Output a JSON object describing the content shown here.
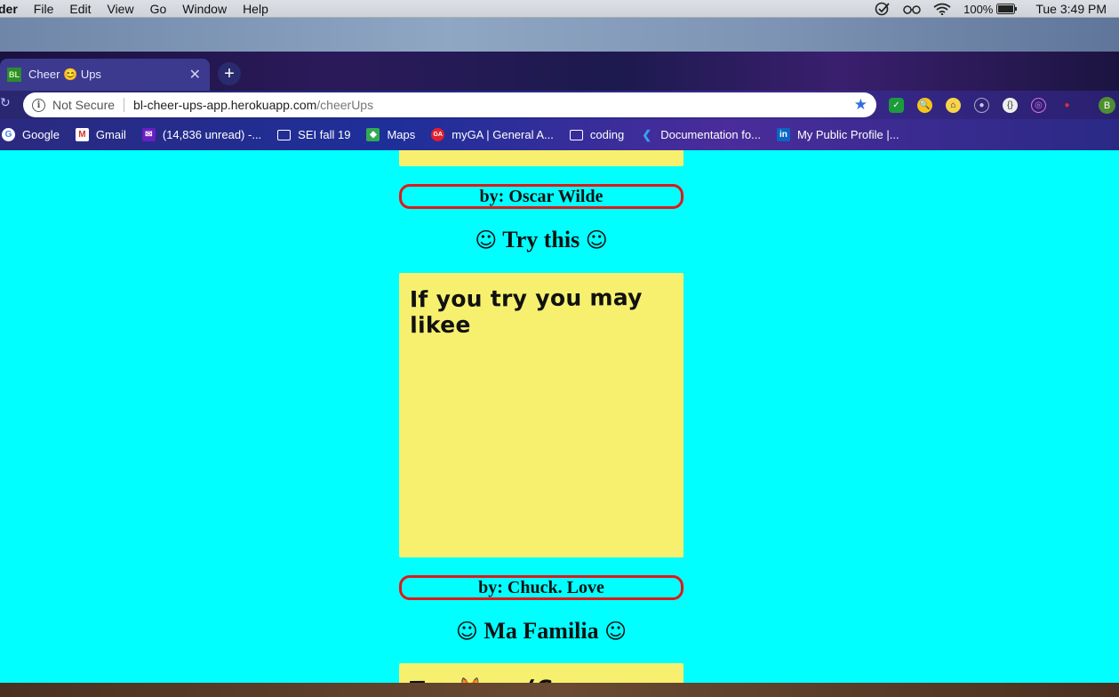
{
  "menubar": {
    "app_name": "der",
    "items": [
      "File",
      "Edit",
      "View",
      "Go",
      "Window",
      "Help"
    ],
    "battery": "100%",
    "clock": "Tue 3:49 PM"
  },
  "browser": {
    "tab_title": "Cheer 😊 Ups",
    "tab_favicon": "BL",
    "security_label": "Not Secure",
    "url_host": "bl-cheer-ups-app.herokuapp.com",
    "url_path": "/cheerUps",
    "profile_initial": "B",
    "bookmarks": [
      {
        "label": "Google",
        "icon": "google-icon"
      },
      {
        "label": "Gmail",
        "icon": "gmail-icon"
      },
      {
        "label": "(14,836 unread) -...",
        "icon": "yahoo-mail-icon"
      },
      {
        "label": "SEI fall 19",
        "icon": "folder-icon"
      },
      {
        "label": "Maps",
        "icon": "maps-icon"
      },
      {
        "label": "myGA | General A...",
        "icon": "ga-icon"
      },
      {
        "label": "coding",
        "icon": "folder-icon"
      },
      {
        "label": "Documentation fo...",
        "icon": "vscode-icon"
      },
      {
        "label": "My Public Profile |...",
        "icon": "linkedin-icon"
      }
    ]
  },
  "page": {
    "background": "#00ffff",
    "note_color": "#f7f06f",
    "author_border": "#e01818",
    "cards": [
      {
        "author": "by: Oscar Wilde"
      },
      {
        "heading": "Try this",
        "text": "If you try you may likee",
        "author": "by: Chuck. Love"
      },
      {
        "heading": "Ma Familia",
        "text": "T... 🦊 ... (C..."
      }
    ]
  }
}
